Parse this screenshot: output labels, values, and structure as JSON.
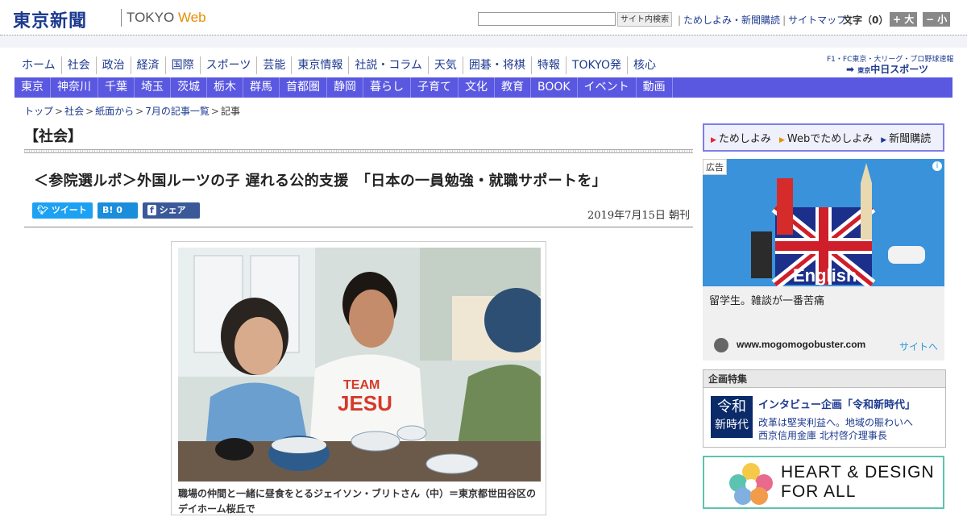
{
  "header": {
    "logo_jp": "東京新聞",
    "logo_en_tokyo": "TOKYO",
    "logo_en_web": "Web",
    "search_button": "サイト内検索",
    "links": [
      "ためしよみ・新聞購読",
      "サイトマップ"
    ],
    "font_label": "文字（0）",
    "font_bigger": "+ 大",
    "font_smaller": "− 小"
  },
  "nav_main": [
    "ホーム",
    "社会",
    "政治",
    "経済",
    "国際",
    "スポーツ",
    "芸能",
    "東京情報",
    "社説・コラム",
    "天気",
    "囲碁・将棋",
    "特報",
    "TOKYO発",
    "核心"
  ],
  "chunichi": {
    "tagline": "F1・FC東京・大リーグ・プロ野球速報",
    "logo_small": "東京",
    "logo_main": "中日スポーツ"
  },
  "nav_region": [
    "東京",
    "神奈川",
    "千葉",
    "埼玉",
    "茨城",
    "栃木",
    "群馬",
    "首都圏",
    "静岡",
    "暮らし",
    "子育て",
    "文化",
    "教育",
    "BOOK",
    "イベント",
    "動画"
  ],
  "breadcrumb": [
    "トップ",
    "社会",
    "紙面から",
    "7月の記事一覧",
    "記事"
  ],
  "article": {
    "section": "【社会】",
    "headline": "＜参院選ルポ＞外国ルーツの子 遅れる公的支援　「日本の一員勉強・就職サポートを」",
    "share_tweet": "ツイート",
    "share_hatena": "B! 0",
    "share_fb": "シェア 0",
    "date": "2019年7月15日 朝刊",
    "caption": "職場の仲間と一緒に昼食をとるジェイソン・ブリトさん（中）＝東京都世田谷区のデイホーム桜丘で"
  },
  "sidebar": {
    "trial_links": [
      "ためしよみ",
      "Webでためしよみ",
      "新聞購読"
    ],
    "ad": {
      "label": "広告",
      "info": "i",
      "close": "✕",
      "banner_word": "English",
      "text": "留学生。雑談が一番苦痛",
      "domain": "www.mogomogobuster.com",
      "site_link": "サイトへ"
    },
    "feature": {
      "header": "企画特集",
      "badge_top": "令和",
      "badge_bottom": "新時代",
      "title": "インタビュー企画「令和新時代」",
      "sub1": "改革は堅実利益へ。地域の賑わいへ",
      "sub2": "西京信用金庫 北村啓介理事長"
    },
    "hd_banner": {
      "line1": "HEART & DESIGN",
      "line2": "FOR ALL"
    }
  },
  "colors": {
    "brand_blue": "#1d3a8f",
    "region_nav": "#5a58e0",
    "web_orange": "#e98d00"
  }
}
